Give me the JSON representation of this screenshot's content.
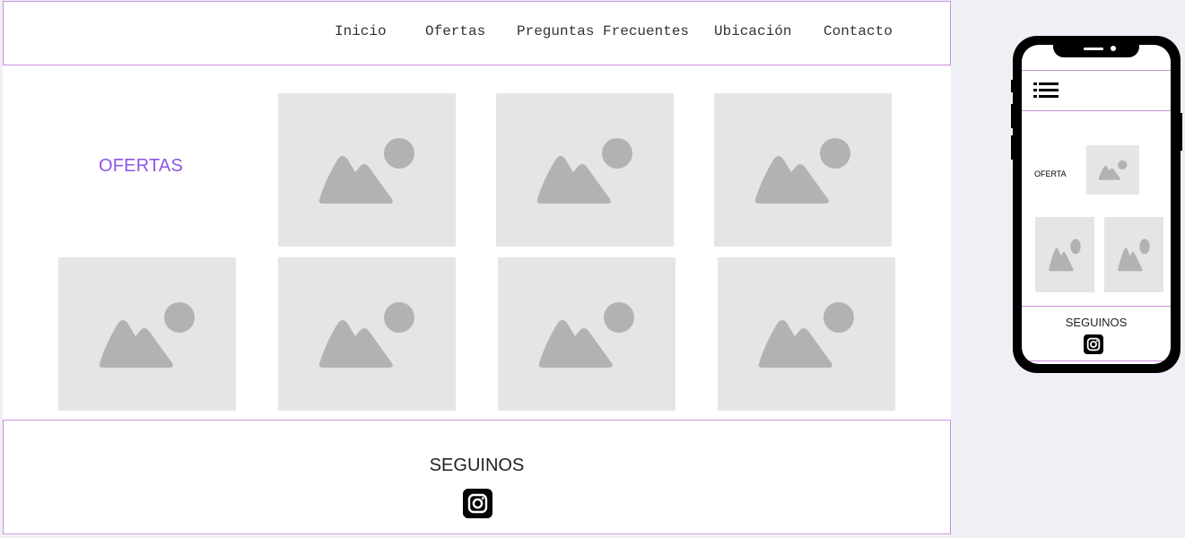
{
  "nav": {
    "items": [
      {
        "label": "Inicio"
      },
      {
        "label": "Ofertas"
      },
      {
        "label": "Preguntas Frecuentes"
      },
      {
        "label": "Ubicación"
      },
      {
        "label": "Contacto"
      }
    ]
  },
  "offers": {
    "title": "OFERTAS"
  },
  "footer": {
    "follow_label": "SEGUINOS",
    "social_icon": "instagram-icon"
  },
  "mobile": {
    "menu_icon": "hamburger-menu-icon",
    "offer_label": "OFERTA",
    "follow_label": "SEGUINOS",
    "social_icon": "instagram-icon"
  },
  "colors": {
    "accent_purple": "#8d55e8",
    "border_pink": "#cc8fdc",
    "placeholder_bg": "#e5e5e5",
    "placeholder_shape": "#b2b2b2",
    "page_bg": "#eef0f5"
  },
  "icons": {
    "image_placeholder": "image-placeholder-icon"
  }
}
